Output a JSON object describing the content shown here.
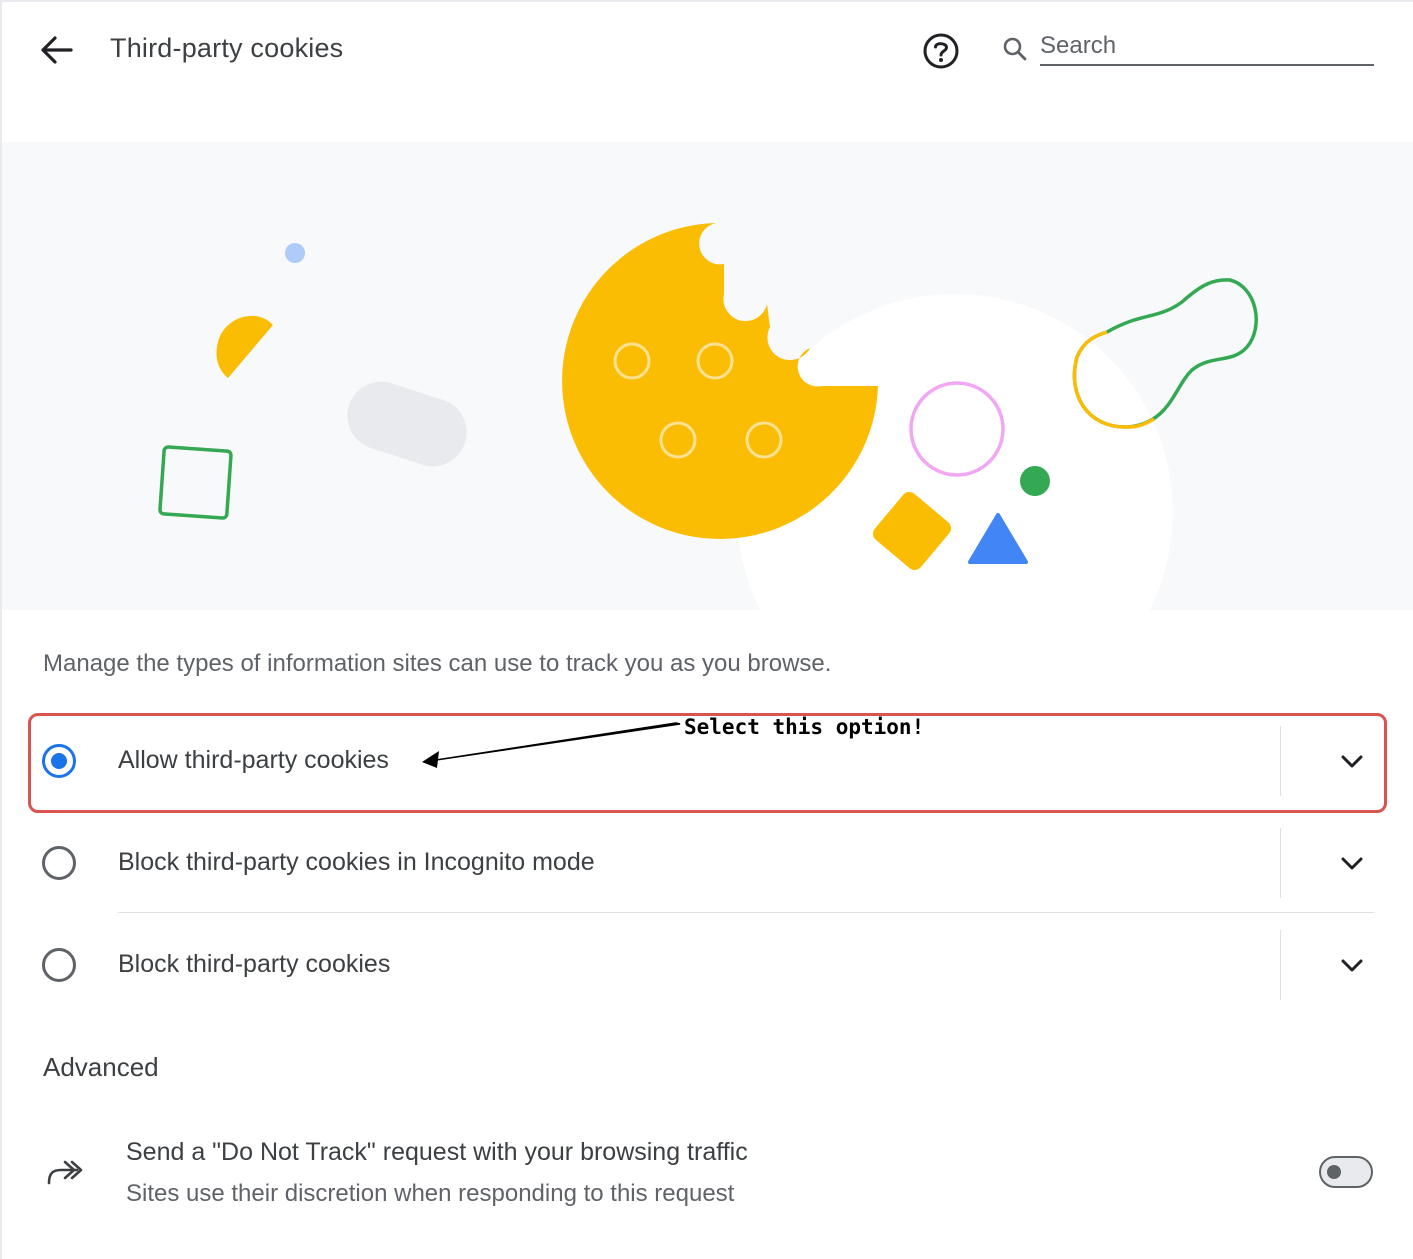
{
  "header": {
    "title": "Third-party cookies",
    "back_icon": "arrow-left-icon",
    "help_icon": "help-circle-icon",
    "search_icon": "search-icon",
    "search_placeholder": "Search",
    "search_value": ""
  },
  "description": "Manage the types of information sites can use to track you as you browse.",
  "options": [
    {
      "label": "Allow third-party cookies",
      "selected": true,
      "expand_icon": "chevron-down-icon"
    },
    {
      "label": "Block third-party cookies in Incognito mode",
      "selected": false,
      "expand_icon": "chevron-down-icon"
    },
    {
      "label": "Block third-party cookies",
      "selected": false,
      "expand_icon": "chevron-down-icon"
    }
  ],
  "annotation": {
    "text": "Select this option!",
    "color": "#d9534f"
  },
  "advanced": {
    "heading": "Advanced",
    "do_not_track": {
      "icon": "redirect-arrow-icon",
      "title": "Send a \"Do Not Track\" request with your browsing traffic",
      "subtitle": "Sites use their discretion when responding to this request",
      "enabled": false
    }
  },
  "colors": {
    "accent": "#1a73e8",
    "cookie_yellow": "#fbbc04",
    "green": "#34a853",
    "blue": "#4285f4",
    "pink": "#f1a7f3"
  }
}
